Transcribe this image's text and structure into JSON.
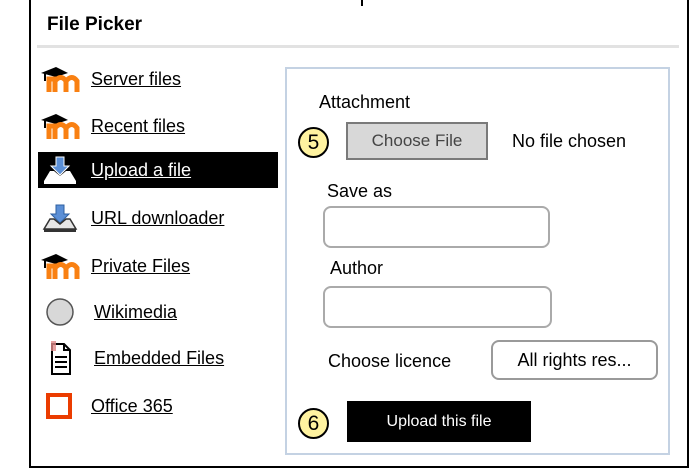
{
  "window": {
    "title": "File Picker"
  },
  "sidebar": {
    "items": [
      {
        "label": "Server files",
        "icon": "moodle-icon",
        "selected": false
      },
      {
        "label": "Recent files",
        "icon": "moodle-icon",
        "selected": false
      },
      {
        "label": "Upload a file",
        "icon": "upload-icon",
        "selected": true
      },
      {
        "label": "URL downloader",
        "icon": "download-icon",
        "selected": false
      },
      {
        "label": "Private Files",
        "icon": "moodle-icon",
        "selected": false
      },
      {
        "label": "Wikimedia",
        "icon": "circle-icon",
        "selected": false
      },
      {
        "label": "Embedded Files",
        "icon": "document-icon",
        "selected": false
      },
      {
        "label": "Office 365",
        "icon": "office-icon",
        "selected": false
      }
    ]
  },
  "form": {
    "attachment_label": "Attachment",
    "choose_file_label": "Choose File",
    "no_file_text": "No file chosen",
    "save_as_label": "Save as",
    "save_as_value": "",
    "author_label": "Author",
    "author_value": "",
    "licence_label": "Choose licence",
    "licence_value": "All rights res...",
    "upload_label": "Upload this file"
  },
  "steps": {
    "step5": "5",
    "step6": "6"
  },
  "colors": {
    "selected_bg": "#000000",
    "moodle_orange": "#f98012",
    "office_red": "#eb3c00",
    "step_badge": "#fff3a0",
    "panel_border": "#c4d2e3"
  }
}
